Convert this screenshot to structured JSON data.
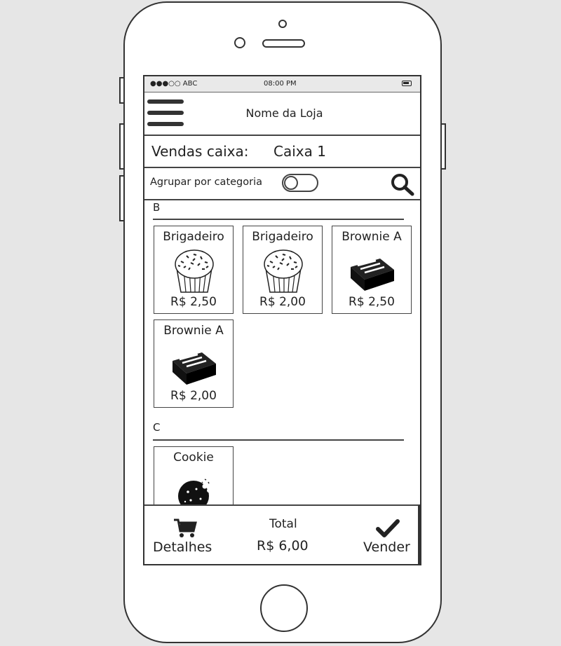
{
  "status_bar": {
    "carrier": "●●●○○ ABC",
    "time": "08:00 PM"
  },
  "header": {
    "store_name": "Nome da Loja"
  },
  "page": {
    "title_label": "Vendas caixa:",
    "title_value": "Caixa 1"
  },
  "filter": {
    "group_by_category_label": "Agrupar por categoria",
    "group_by_category_on": false
  },
  "categories": [
    {
      "letter": "B",
      "products": [
        {
          "name": "Brigadeiro",
          "price": "R$ 2,50",
          "image": "brigadeiro-image"
        },
        {
          "name": "Brigadeiro",
          "price": "R$ 2,00",
          "image": "brigadeiro-image"
        },
        {
          "name": "Brownie A",
          "price": "R$ 2,50",
          "image": "brownie-image"
        },
        {
          "name": "Brownie A",
          "price": "R$ 2,00",
          "image": "brownie-image"
        }
      ]
    },
    {
      "letter": "C",
      "products": [
        {
          "name": "Cookie",
          "price": "",
          "image": "cookie-image"
        }
      ]
    }
  ],
  "bottom_bar": {
    "details_label": "Detalhes",
    "total_label": "Total",
    "total_value": "R$ 6,00",
    "sell_label": "Vender"
  },
  "icons": [
    "menu-icon",
    "search-icon",
    "cart-icon",
    "check-icon",
    "battery-icon"
  ]
}
